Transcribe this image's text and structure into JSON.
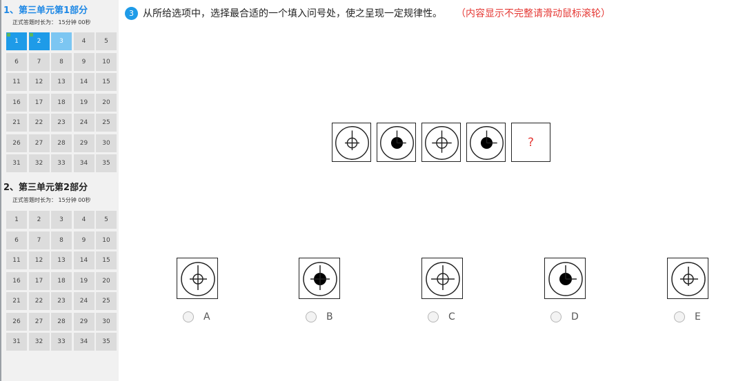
{
  "sidebar": {
    "sections": [
      {
        "title": "1、第三单元第1部分",
        "duration_label": "正式答题时长为：",
        "duration_value": "15分钟 00秒",
        "questions": [
          "1",
          "2",
          "3",
          "4",
          "5",
          "6",
          "7",
          "8",
          "9",
          "10",
          "11",
          "12",
          "13",
          "14",
          "15",
          "16",
          "17",
          "18",
          "19",
          "20",
          "21",
          "22",
          "23",
          "24",
          "25",
          "26",
          "27",
          "28",
          "29",
          "30",
          "31",
          "32",
          "33",
          "34",
          "35"
        ],
        "answered": [
          "1",
          "2"
        ],
        "current": "3"
      },
      {
        "title": "2、第三单元第2部分",
        "duration_label": "正式答题时长为：",
        "duration_value": "15分钟 00秒",
        "questions": [
          "1",
          "2",
          "3",
          "4",
          "5",
          "6",
          "7",
          "8",
          "9",
          "10",
          "11",
          "12",
          "13",
          "14",
          "15",
          "16",
          "17",
          "18",
          "19",
          "20",
          "21",
          "22",
          "23",
          "24",
          "25",
          "26",
          "27",
          "28",
          "29",
          "30",
          "31",
          "32",
          "33",
          "34",
          "35"
        ],
        "answered": [],
        "current": ""
      }
    ]
  },
  "question": {
    "number": "3",
    "text": "从所给选项中，选择最合适的一个填入问号处，使之呈现一定规律性。",
    "note": "（内容显示不完整请滑动鼠标滚轮）",
    "sequence_missing": "?"
  },
  "options": [
    {
      "label": "A"
    },
    {
      "label": "B"
    },
    {
      "label": "C"
    },
    {
      "label": "D"
    },
    {
      "label": "E"
    }
  ],
  "colors": {
    "accent": "#1e9be8",
    "current": "#7cc6f2",
    "warning": "#e53935",
    "cell": "#dcdcdc"
  }
}
